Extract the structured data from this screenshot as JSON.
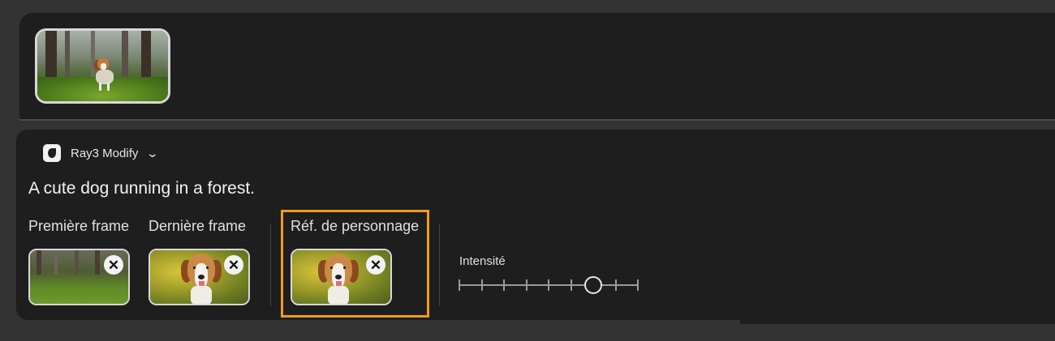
{
  "top": {
    "thumbnail_alt": "A dog running through a mossy forest"
  },
  "model": {
    "name": "Ray3 Modify",
    "icon": "luma-logo-icon",
    "dropdown_icon": "chevron-down-icon"
  },
  "prompt": {
    "text": "A cute dog running in a forest."
  },
  "frames": {
    "first_label": "Première frame",
    "last_label": "Dernière frame",
    "character_ref_label": "Réf. de personnage",
    "remove_symbol": "✕"
  },
  "intensity": {
    "label": "Intensité",
    "value": 0.75
  },
  "colors": {
    "highlight": "#f29a1d",
    "panel": "#1e1e1e",
    "background": "#333333"
  }
}
